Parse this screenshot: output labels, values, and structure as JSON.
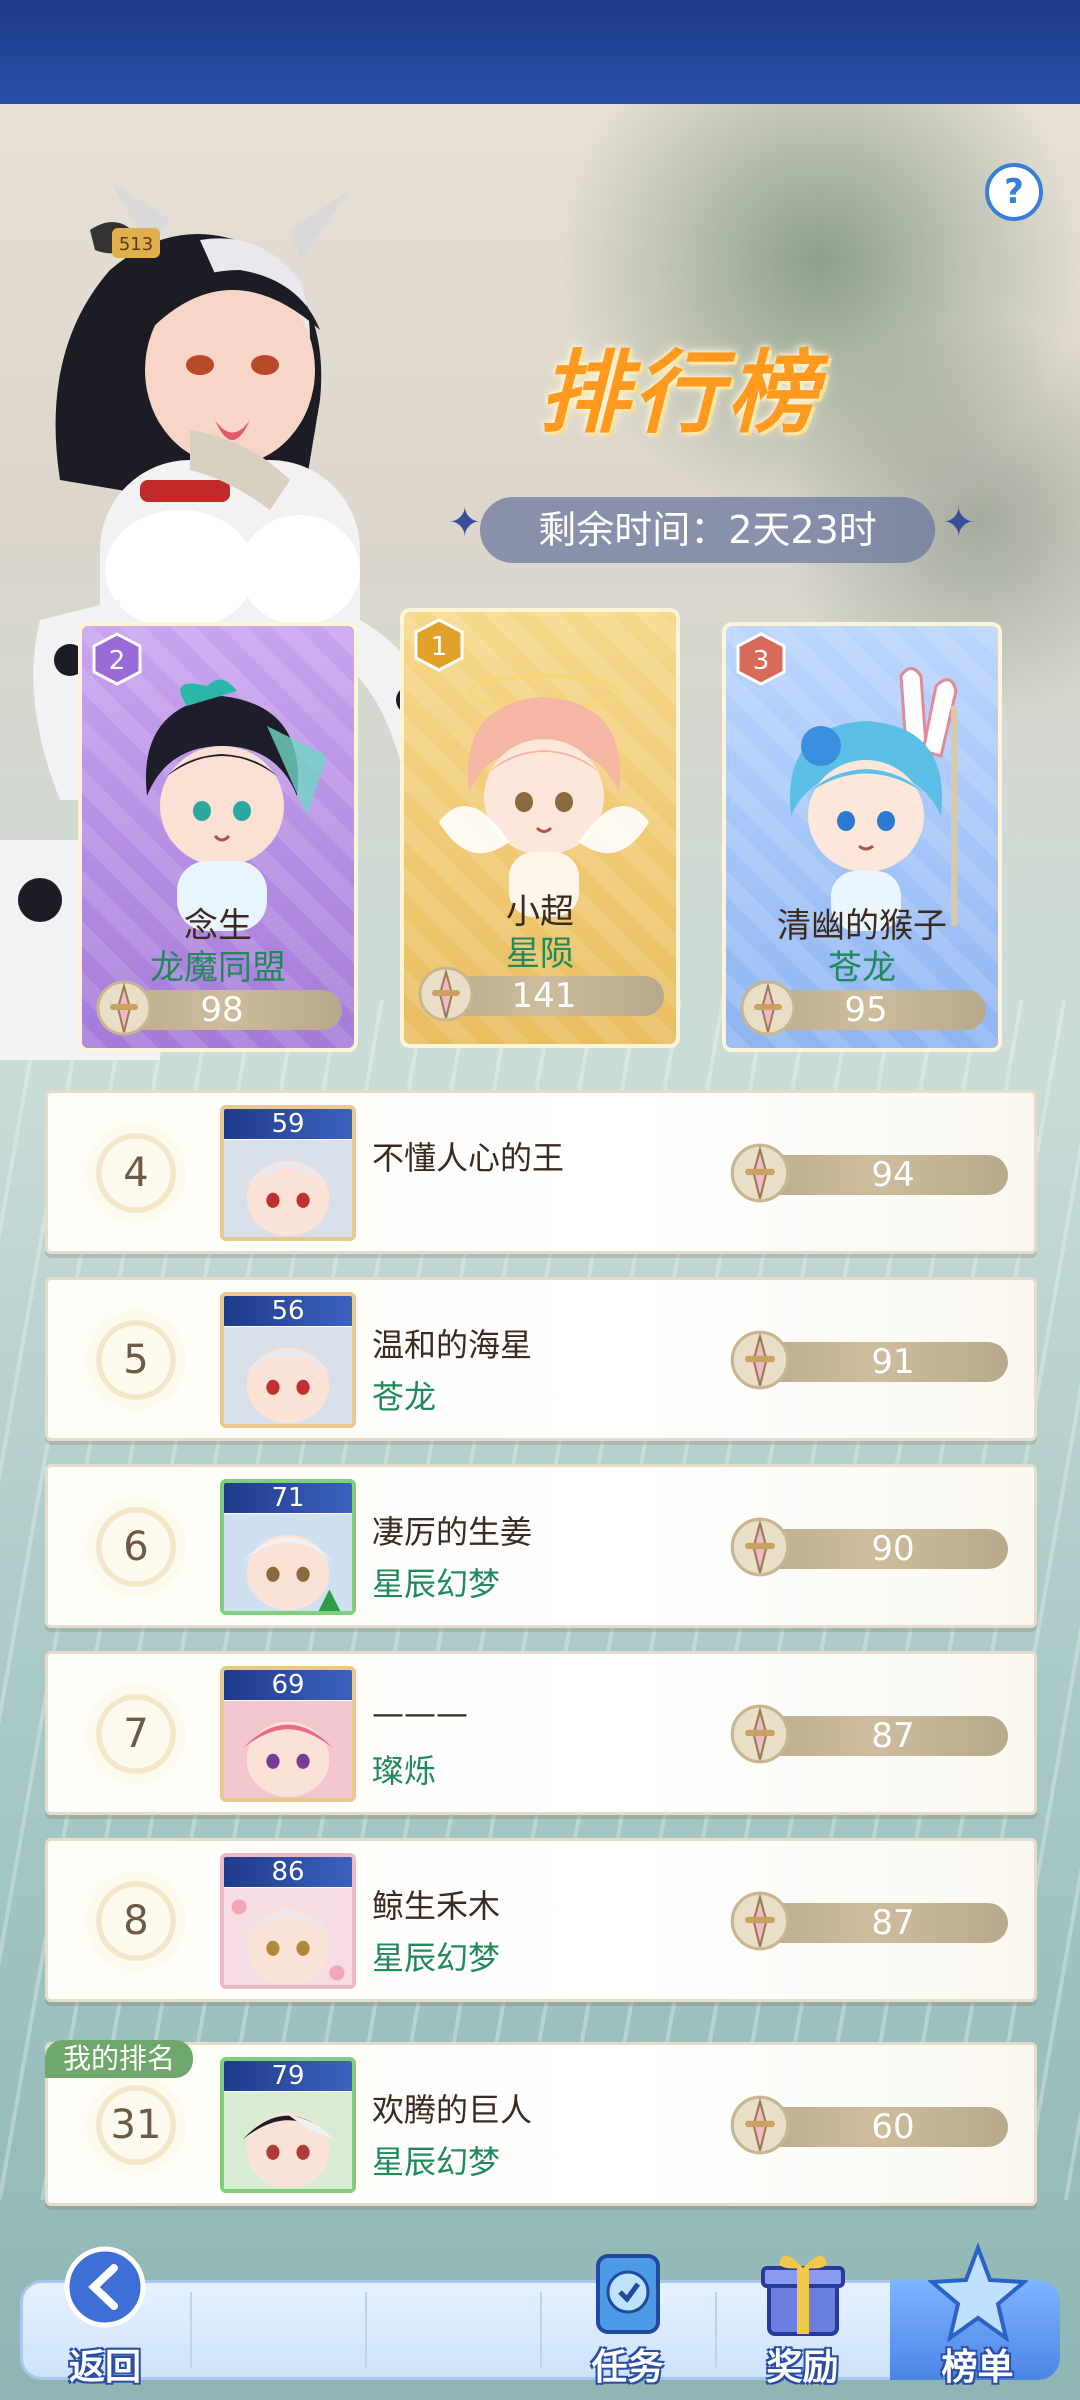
{
  "title": "排行榜",
  "remaining_time": "剩余时间：2天23时",
  "top3": [
    {
      "rank": "2",
      "name": "念生",
      "guild": "龙魔同盟",
      "score": "98"
    },
    {
      "rank": "1",
      "name": "小超",
      "guild": "星陨",
      "score": "141"
    },
    {
      "rank": "3",
      "name": "清幽的猴子",
      "guild": "苍龙",
      "score": "95"
    }
  ],
  "rows": [
    {
      "rank": "4",
      "level": "59",
      "name": "不懂人心的王",
      "guild": "",
      "score": "94"
    },
    {
      "rank": "5",
      "level": "56",
      "name": "温和的海星",
      "guild": "苍龙",
      "score": "91"
    },
    {
      "rank": "6",
      "level": "71",
      "name": "凄厉的生姜",
      "guild": "星辰幻梦",
      "score": "90"
    },
    {
      "rank": "7",
      "level": "69",
      "name": "———",
      "guild": "璨烁",
      "score": "87"
    },
    {
      "rank": "8",
      "level": "86",
      "name": "鲸生禾木",
      "guild": "星辰幻梦",
      "score": "87"
    }
  ],
  "my_rank": {
    "tag": "我的排名",
    "rank": "31",
    "level": "79",
    "name": "欢腾的巨人",
    "guild": "星辰幻梦",
    "score": "60"
  },
  "nav": {
    "back": "返回",
    "tasks": "任务",
    "rewards": "奖励",
    "ranking": "榜单"
  },
  "help_label": "?",
  "badge_number": "513",
  "colors": {
    "accent": "#2a4ea6",
    "guild_text": "#1f8a5a",
    "title": "#ff9a1e"
  },
  "icons": [
    "help-icon",
    "sword-trophy-icon",
    "back-icon",
    "task-scroll-icon",
    "gift-box-icon",
    "ranking-star-icon"
  ]
}
